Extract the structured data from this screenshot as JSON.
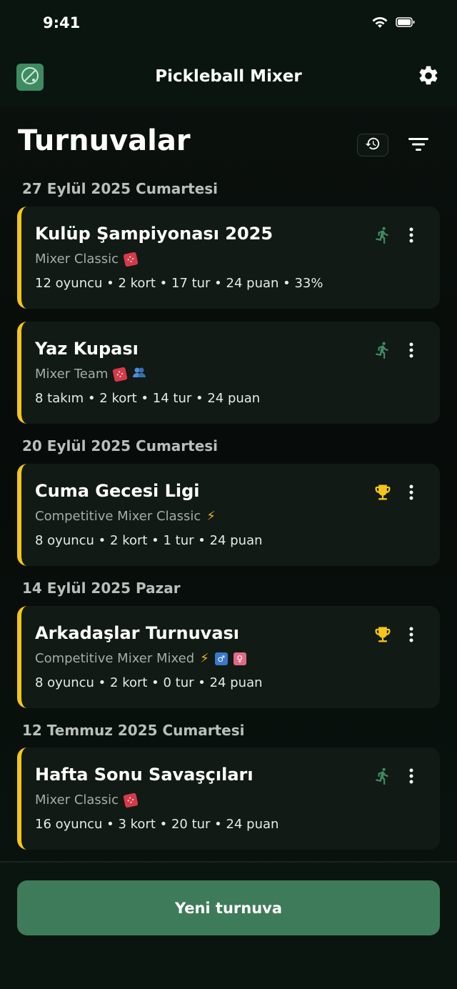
{
  "status_bar": {
    "time": "9:41"
  },
  "header": {
    "title": "Pickleball Mixer",
    "logo_icon": "racket-icon",
    "settings_icon": "gear-icon"
  },
  "page": {
    "title": "Turnuvalar"
  },
  "colors": {
    "accent": "#3e7b5b",
    "card_border": "#f5c518",
    "running": "#3e8b62",
    "trophy": "#f5c518"
  },
  "groups": [
    {
      "date": "27 Eylül 2025 Cumartesi",
      "cards": [
        {
          "title": "Kulüp Şampiyonası 2025",
          "subtitle": "Mixer Classic",
          "status": "running",
          "meta": "12 oyuncu  •  2 kort  •  17 tur  •  24 puan  •  33%"
        },
        {
          "title": "Yaz Kupası",
          "subtitle": "Mixer Team",
          "status": "running",
          "meta": "8 takım  •  2 kort  •  14 tur  •  24 puan"
        }
      ]
    },
    {
      "date": "20 Eylül 2025 Cumartesi",
      "cards": [
        {
          "title": "Cuma Gecesi Ligi",
          "subtitle": "Competitive Mixer Classic",
          "status": "finished",
          "meta": "8 oyuncu  •  2 kort  •  1 tur  •  24 puan"
        }
      ]
    },
    {
      "date": "14 Eylül 2025 Pazar",
      "cards": [
        {
          "title": "Arkadaşlar Turnuvası",
          "subtitle": "Competitive Mixer Mixed",
          "status": "finished",
          "meta": "8 oyuncu  •  2 kort  •  0 tur  •  24 puan"
        }
      ]
    },
    {
      "date": "12 Temmuz 2025 Cumartesi",
      "cards": [
        {
          "title": "Hafta Sonu Savaşçıları",
          "subtitle": "Mixer Classic",
          "status": "running",
          "meta": "16 oyuncu  •  3 kort  •  20 tur  •  24 puan"
        }
      ]
    }
  ],
  "footer": {
    "new_button_label": "Yeni turnuva"
  }
}
